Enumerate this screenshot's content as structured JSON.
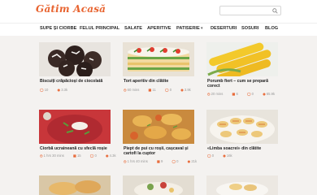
{
  "site": {
    "logo": "Gătim Acasă",
    "search_placeholder": ""
  },
  "nav": {
    "items": [
      "SUPE ȘI CIORBE",
      "FELUL PRINCIPAL",
      "SALATE",
      "APERITIVE",
      "PATISERIE",
      "DESERTURI",
      "SOSURI",
      "BLOG"
    ],
    "dropdown_icon": "chevron-down-icon"
  },
  "cards": [
    {
      "title": "Biscuiți crăpăcioși de ciocolată",
      "time": "",
      "ingredients": "",
      "comments": "10",
      "views": "3.3k"
    },
    {
      "title": "Tort aperitiv din clătite",
      "time": "60 mins",
      "ingredients": "11",
      "comments": "0",
      "views": "3.9k"
    },
    {
      "title": "Porumb fiert – cum se prepară corect",
      "time": "20 mins",
      "ingredients": "6",
      "comments": "0",
      "views": "65.9k"
    },
    {
      "title": "Ciorbă ucraineană cu sfeclă roșie",
      "time": "1 hrs 30 mins",
      "ingredients": "15",
      "comments": "0",
      "views": "4.3k"
    },
    {
      "title": "Piept de pui cu roșii, cașcaval și cartofi la cuptor",
      "time": "1 hrs 40 mins",
      "ingredients": "9",
      "comments": "0",
      "views": "21k"
    },
    {
      "title": "«Limba soacrei» din clătite",
      "time": "",
      "ingredients": "",
      "comments": "0",
      "views": "16k"
    }
  ],
  "colors": {
    "accent": "#e8632f",
    "background": "#f4f2f0"
  }
}
